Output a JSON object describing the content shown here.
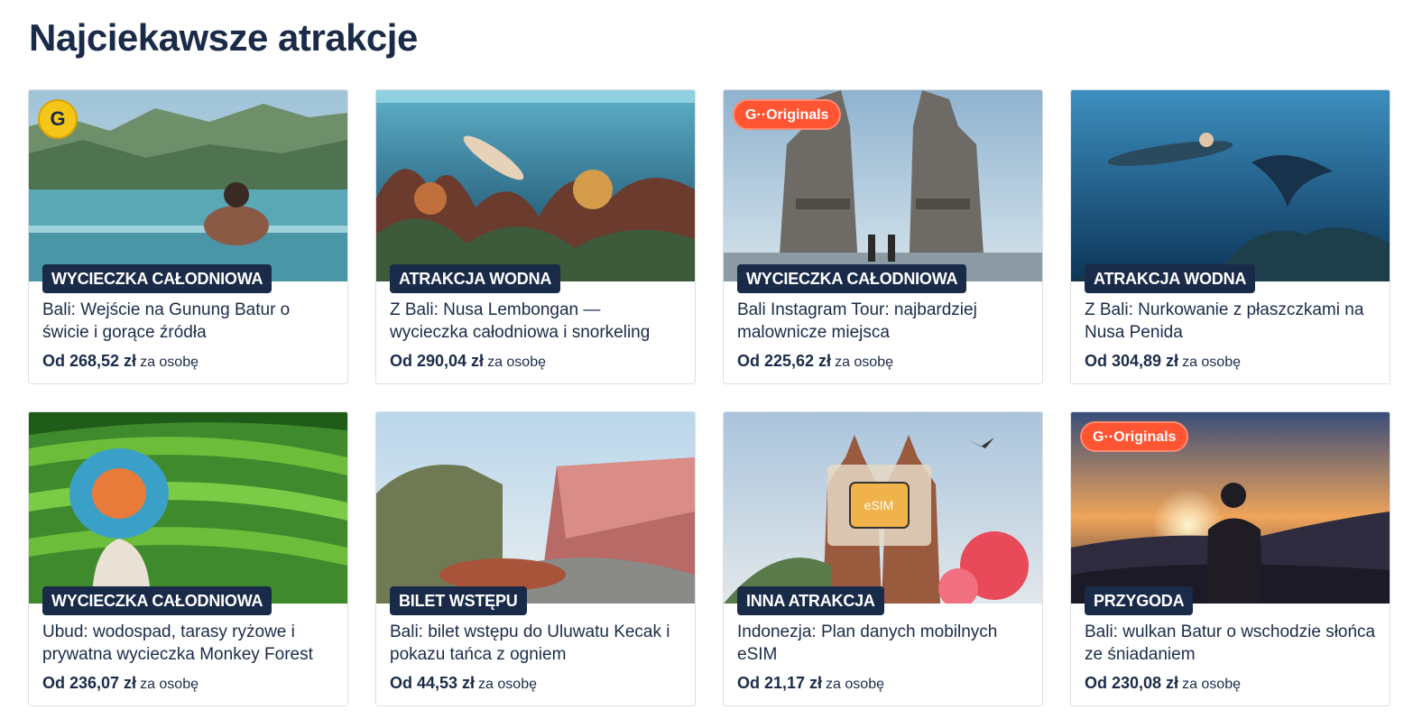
{
  "page": {
    "title": "Najciekawsze atrakcje"
  },
  "price_suffix": "za osobę",
  "originals_label": "G··Originals",
  "coin_label": "G",
  "cards": [
    {
      "category": "WYCIECZKA CAŁODNIOWA",
      "title": "Bali: Wejście na Gunung Batur o świcie i gorące źródła",
      "price": "Od 268,52 zł",
      "badge": "coin",
      "image": "hot-spring-pool"
    },
    {
      "category": "ATRAKCJA WODNA",
      "title": "Z Bali: Nusa Lembongan — wycieczka całodniowa i snorkeling",
      "price": "Od 290,04 zł",
      "badge": "",
      "image": "snorkel-reef"
    },
    {
      "category": "WYCIECZKA CAŁODNIOWA",
      "title": "Bali Instagram Tour: najbardziej malownicze miejsca",
      "price": "Od 225,62 zł",
      "badge": "originals",
      "image": "temple-gate"
    },
    {
      "category": "ATRAKCJA WODNA",
      "title": "Z Bali: Nurkowanie z płaszczkami na Nusa Penida",
      "price": "Od 304,89 zł",
      "badge": "",
      "image": "manta-dive"
    },
    {
      "category": "WYCIECZKA CAŁODNIOWA",
      "title": "Ubud: wodospad, tarasy ryżowe i prywatna wycieczka Monkey Forest",
      "price": "Od 236,07 zł",
      "badge": "",
      "image": "rice-terraces"
    },
    {
      "category": "BILET WSTĘPU",
      "title": "Bali: bilet wstępu do Uluwatu Kecak i pokazu tańca z ogniem",
      "price": "Od 44,53 zł",
      "badge": "",
      "image": "kecak-amphitheatre"
    },
    {
      "category": "INNA ATRAKCJA",
      "title": "Indonezja: Plan danych mobilnych eSIM",
      "price": "Od 21,17 zł",
      "badge": "",
      "image": "esim-temple",
      "esim_label": "eSIM"
    },
    {
      "category": "PRZYGODA",
      "title": "Bali: wulkan Batur o wschodzie słońca ze śniadaniem",
      "price": "Od 230,08 zł",
      "badge": "originals",
      "image": "volcano-sunrise"
    }
  ]
}
